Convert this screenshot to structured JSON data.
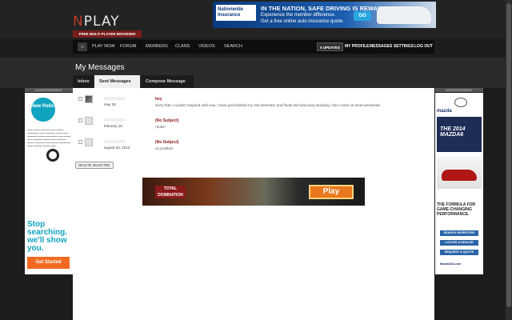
{
  "header": {
    "logo_first": "N",
    "logo_rest": "PLAY",
    "tagline": "FREE MULTI-PLAYER BROWSER GAMES"
  },
  "top_ad": {
    "brand": "Nationwide Insurance",
    "headline": "IN THE NATION, SAFE DRIVING IS REWARDED",
    "sub1": "Experience the member difference.",
    "sub2": "Get a free online auto insurance quote.",
    "cta": "GO"
  },
  "nav": {
    "left": [
      "PLAY NOW",
      "FORUM",
      "MEMBERS",
      "CLANS",
      "VIDEOS",
      "SEARCH"
    ],
    "updates": "0 UPDATES",
    "right": [
      "MY PROFILE",
      "MESSAGES",
      "SETTINGS",
      "LOG OUT"
    ]
  },
  "page": {
    "title": "My Messages",
    "tabs": [
      "Inbox",
      "Sent Messages",
      "Compose Message"
    ]
  },
  "ads": {
    "label": "ADVERTISEMENT",
    "left": {
      "brand": "New Relic.",
      "headline": "Stop searching. we'll show you.",
      "cta": "Get Started"
    },
    "right": {
      "brand": "mazda",
      "model": "THE 2014 MAZDA6",
      "tagline": "THE FORMULA FOR GAME-CHANGING PERFORMANCE.",
      "buttons": [
        "SEARCH INVENTORY",
        "LOCATE A DEALER",
        "REQUEST A QUOTE"
      ],
      "site": "MazdaUSA.com"
    },
    "game": {
      "logo": "TOTAL DOMINATION",
      "cta": "Play"
    }
  },
  "messages": [
    {
      "date": "may 25",
      "subject": "hey",
      "body": "Sorry that I couldn't respond until now. I have just finished my 2nd semester and finals and was busy studying. Also I work on most weekends."
    },
    {
      "date": "february 15",
      "subject": "(No Subject)",
      "body": "*poke*"
    },
    {
      "date": "august 25, 2012",
      "subject": "(No Subject)",
      "body": "no problem"
    }
  ],
  "actions": {
    "delete": "DELETE SELECTED"
  }
}
